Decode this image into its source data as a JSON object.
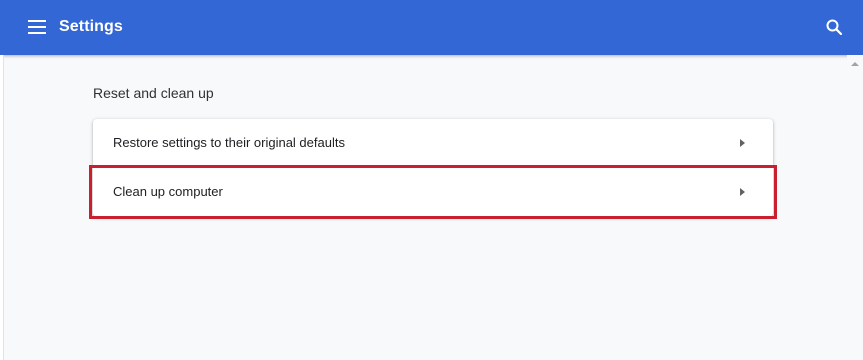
{
  "header": {
    "title": "Settings",
    "menu_icon": "hamburger-menu-icon",
    "search_icon": "search-icon"
  },
  "colors": {
    "toolbar": "#3367d6",
    "background": "#f8f9fa",
    "highlight": "#c8202f"
  },
  "section": {
    "heading": "Reset and clean up",
    "items": [
      {
        "label": "Restore settings to their original defaults",
        "icon": "chevron-right-icon"
      },
      {
        "label": "Clean up computer",
        "icon": "chevron-right-icon",
        "highlighted": true
      }
    ]
  }
}
